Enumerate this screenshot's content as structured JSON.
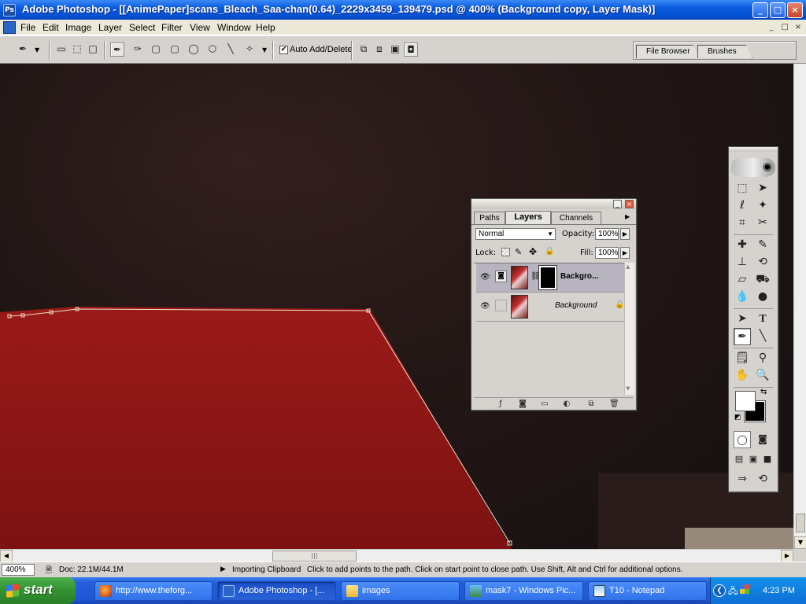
{
  "window": {
    "title": "Adobe Photoshop - [[AnimePaper]scans_Bleach_Saa-chan(0.64)_2229x3459_139479.psd @ 400% (Background copy, Layer Mask)]",
    "buttons": [
      "_",
      "□",
      "×"
    ]
  },
  "menu": {
    "items": [
      "File",
      "Edit",
      "Image",
      "Layer",
      "Select",
      "Filter",
      "View",
      "Window",
      "Help"
    ],
    "doc_buttons": [
      "_",
      "□",
      "×"
    ]
  },
  "options": {
    "auto_add_delete_label": "Auto Add/Delete",
    "auto_add_delete_checked": true,
    "palette_well_tabs": [
      "File Browser",
      "Brushes"
    ]
  },
  "status": {
    "zoom": "400%",
    "doc_info": "Doc: 22.1M/44.1M",
    "progress": "Importing Clipboard",
    "hint": "Click to add points to the path.  Click on start point to close path.  Use Shift, Alt and Ctrl for additional options."
  },
  "layers_palette": {
    "tabs": [
      "Paths",
      "Layers",
      "Channels"
    ],
    "active_tab": "Layers",
    "blend_mode": "Normal",
    "opacity_label": "Opacity:",
    "opacity": "100%",
    "lock_label": "Lock:",
    "fill_label": "Fill:",
    "fill": "100%",
    "layers": [
      {
        "name": "Backgro...",
        "visible": true,
        "selected": true,
        "has_mask": true
      },
      {
        "name": "Background",
        "visible": true,
        "selected": false,
        "locked": true
      }
    ]
  },
  "colors": {
    "foreground": "#ffffff",
    "background": "#000000",
    "canvas_red": "#8a1514",
    "canvas_dark": "#1f1414"
  },
  "taskbar": {
    "start_label": "start",
    "tasks": [
      {
        "label": "http://www.theforg...",
        "icon": "firefox-icon",
        "active": false
      },
      {
        "label": "Adobe Photoshop - [...",
        "icon": "photoshop-icon",
        "active": true
      },
      {
        "label": "images",
        "icon": "folder-icon",
        "active": false
      },
      {
        "label": "mask7 - Windows Pic...",
        "icon": "picture-viewer-icon",
        "active": false
      },
      {
        "label": "T10 - Notepad",
        "icon": "notepad-icon",
        "active": false
      }
    ],
    "clock": "4:23 PM"
  }
}
